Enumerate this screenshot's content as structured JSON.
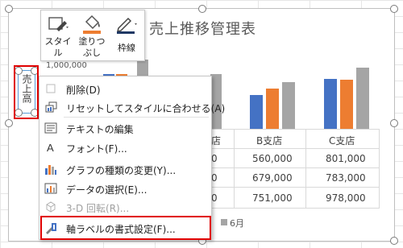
{
  "chart": {
    "title": "売上推移管理表",
    "axis_title": "売上高",
    "ytick_top": "1,000,000",
    "legend_last": "6月",
    "table": {
      "col_headers": [
        "B支店",
        "C支店"
      ],
      "col_partial": "店",
      "rows": [
        {
          "partial": "0",
          "b": "560,000",
          "c": "801,000"
        },
        {
          "partial": "0",
          "b": "679,000",
          "c": "783,000"
        },
        {
          "partial": "0",
          "b": "751,000",
          "c": "978,000"
        }
      ]
    },
    "colors": {
      "series1": "#4472c4",
      "series2": "#ed7d31",
      "series3": "#a5a5a5",
      "selection": "#e00000"
    }
  },
  "mini_toolbar": {
    "style": {
      "label_line1": "スタイ",
      "label_line2": "ル",
      "icon": "brush-style-icon"
    },
    "fill": {
      "label_line1": "塗りつ",
      "label_line2": "ぶし",
      "icon": "paint-bucket-icon"
    },
    "outline": {
      "label": "枠線",
      "icon": "pen-outline-icon"
    }
  },
  "context_menu": {
    "items": [
      {
        "label": "削除(D)",
        "icon": "delete-icon",
        "enabled": true
      },
      {
        "label": "リセットしてスタイルに合わせる(A)",
        "icon": "reset-style-icon",
        "enabled": true
      },
      {
        "label": "テキストの編集",
        "icon": "edit-text-icon",
        "enabled": true
      },
      {
        "label": "フォント(F)...",
        "icon": "font-icon",
        "enabled": true
      },
      {
        "label": "グラフの種類の変更(Y)...",
        "icon": "chart-type-icon",
        "enabled": true
      },
      {
        "label": "データの選択(E)...",
        "icon": "select-data-icon",
        "enabled": true
      },
      {
        "label": "3-D 回転(R)...",
        "icon": "rotate-3d-icon",
        "enabled": false
      },
      {
        "label": "軸ラベルの書式設定(F)...",
        "icon": "format-axis-label-icon",
        "enabled": true
      }
    ]
  }
}
